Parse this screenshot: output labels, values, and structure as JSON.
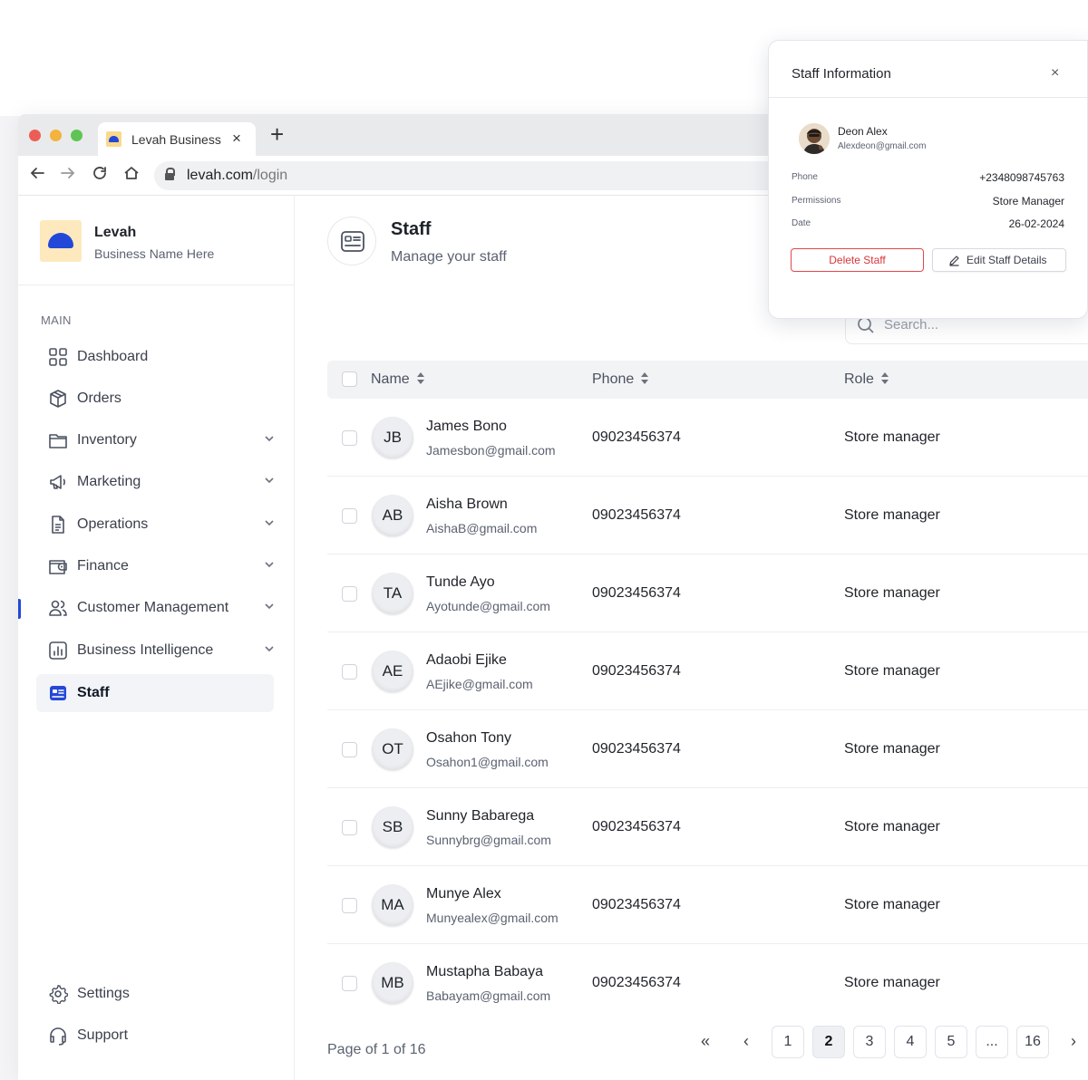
{
  "browser": {
    "tab_title": "Levah Business",
    "url_host": "levah.com",
    "url_path": "/login"
  },
  "brand": {
    "name": "Levah",
    "subtitle": "Business Name Here"
  },
  "sidebar": {
    "section_label": "MAIN",
    "items": [
      {
        "label": "Dashboard",
        "icon": "grid-icon",
        "expandable": false
      },
      {
        "label": "Orders",
        "icon": "box-icon",
        "expandable": false
      },
      {
        "label": "Inventory",
        "icon": "folder-icon",
        "expandable": true
      },
      {
        "label": "Marketing",
        "icon": "megaphone-icon",
        "expandable": true
      },
      {
        "label": "Operations",
        "icon": "document-icon",
        "expandable": true
      },
      {
        "label": "Finance",
        "icon": "wallet-icon",
        "expandable": true
      },
      {
        "label": "Customer Management",
        "icon": "users-icon",
        "expandable": true
      },
      {
        "label": "Business Intelligence",
        "icon": "chart-icon",
        "expandable": true
      },
      {
        "label": "Staff",
        "icon": "id-card-icon",
        "expandable": false,
        "active": true
      }
    ],
    "footer_items": [
      {
        "label": "Settings",
        "icon": "gear-icon"
      },
      {
        "label": "Support",
        "icon": "headset-icon"
      }
    ]
  },
  "page": {
    "title": "Staff",
    "subtitle": "Manage your staff",
    "search_placeholder": "Search..."
  },
  "table": {
    "columns": [
      "Name",
      "Phone",
      "Role"
    ],
    "rows": [
      {
        "initials": "JB",
        "name": "James Bono",
        "email": "Jamesbon@gmail.com",
        "phone": "09023456374",
        "role": "Store manager"
      },
      {
        "initials": "AB",
        "name": "Aisha Brown",
        "email": "AishaB@gmail.com",
        "phone": "09023456374",
        "role": "Store manager"
      },
      {
        "initials": "TA",
        "name": "Tunde Ayo",
        "email": "Ayotunde@gmail.com",
        "phone": "09023456374",
        "role": "Store manager"
      },
      {
        "initials": "AE",
        "name": "Adaobi Ejike",
        "email": "AEjike@gmail.com",
        "phone": "09023456374",
        "role": "Store manager"
      },
      {
        "initials": "OT",
        "name": "Osahon Tony",
        "email": "Osahon1@gmail.com",
        "phone": "09023456374",
        "role": "Store manager"
      },
      {
        "initials": "SB",
        "name": "Sunny Babarega",
        "email": "Sunnybrg@gmail.com",
        "phone": "09023456374",
        "role": "Store manager"
      },
      {
        "initials": "MA",
        "name": "Munye Alex",
        "email": "Munyealex@gmail.com",
        "phone": "09023456374",
        "role": "Store manager"
      },
      {
        "initials": "MB",
        "name": "Mustapha Babaya",
        "email": "Babayam@gmail.com",
        "phone": "09023456374",
        "role": "Store manager"
      }
    ]
  },
  "pagination": {
    "info": "Page of 1 of 16",
    "first": "«",
    "prev": "‹",
    "next": "›",
    "pages": [
      "1",
      "2",
      "3",
      "4",
      "5",
      "...",
      "16"
    ],
    "current": "2"
  },
  "staff_popup": {
    "title": "Staff Information",
    "close": "×",
    "name": "Deon Alex",
    "email": "Alexdeon@gmail.com",
    "fields": [
      {
        "label": "Phone",
        "value": "+2348098745763"
      },
      {
        "label": "Permissions",
        "value": "Store Manager"
      },
      {
        "label": "Date",
        "value": "26-02-2024"
      }
    ],
    "delete_label": "Delete Staff",
    "edit_label": "Edit Staff Details"
  },
  "colors": {
    "accent": "#2348d8",
    "danger": "#d9363a",
    "brand_bg": "#fde9bd"
  }
}
